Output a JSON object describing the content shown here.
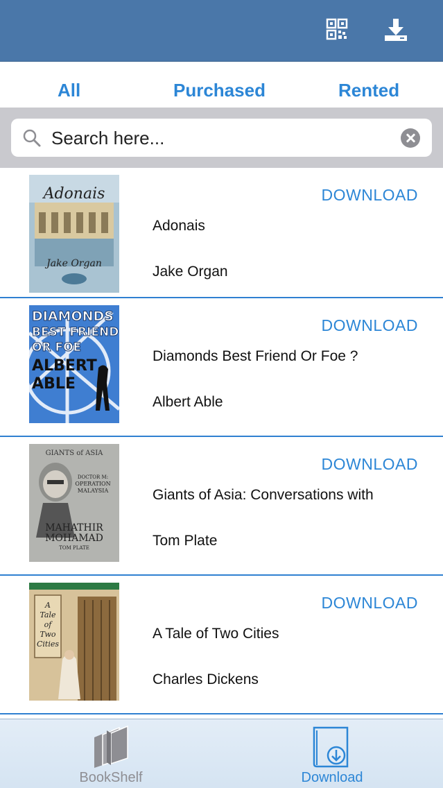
{
  "navbar": {
    "qr_icon": "qr-code-icon",
    "download_icon": "download-tray-icon"
  },
  "segments": [
    "All",
    "Purchased",
    "Rented"
  ],
  "search": {
    "placeholder": "Search here...",
    "value": ""
  },
  "books": [
    {
      "title": "Adonais",
      "author": "Jake Organ",
      "action": "DOWNLOAD",
      "cover": {
        "text": "Adonais",
        "subtext": "Jake Organ",
        "bg": "#9ab7c9"
      }
    },
    {
      "title": "Diamonds Best Friend Or Foe ?",
      "author": "Albert Able",
      "action": "DOWNLOAD",
      "cover": {
        "text": "DIAMONDS BEST FRIEND OR FOE",
        "subtext": "ALBERT ABLE",
        "bg": "#3f7ed1"
      }
    },
    {
      "title": "Giants of Asia: Conversations with",
      "author": "Tom Plate",
      "action": "DOWNLOAD",
      "cover": {
        "text": "GIANTS of ASIA",
        "subtext": "MAHATHIR MOHAMAD",
        "bg": "#b0b1ad"
      }
    },
    {
      "title": "A Tale of Two Cities",
      "author": "Charles Dickens",
      "action": "DOWNLOAD",
      "cover": {
        "text": "A Tale of Two Cities",
        "subtext": "Charles Dickens",
        "bg": "#c9ae83"
      }
    }
  ],
  "tabbar": {
    "tabs": [
      {
        "label": "BookShelf",
        "icon": "books-icon",
        "active": false
      },
      {
        "label": "Download",
        "icon": "download-book-icon",
        "active": true
      }
    ]
  },
  "colors": {
    "navbar": "#4a77a9",
    "accent": "#2c86d6",
    "separator": "#2f80d1",
    "search_bg": "#c9c9ce"
  }
}
